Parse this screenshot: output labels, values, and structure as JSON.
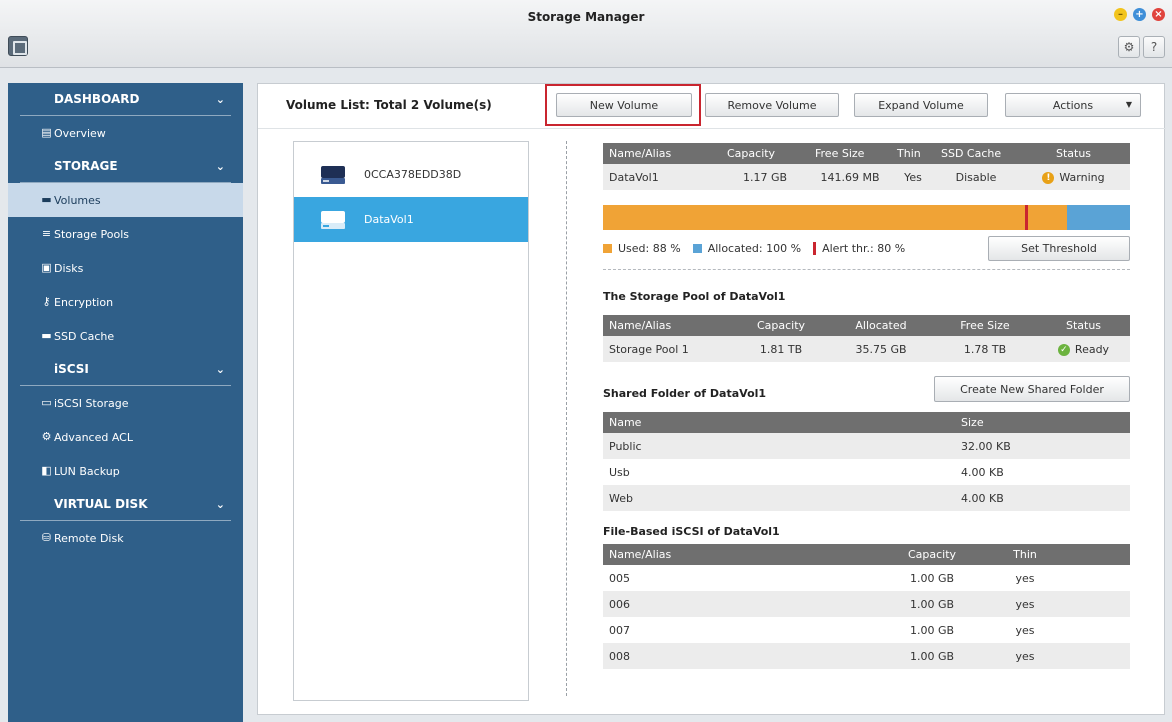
{
  "window": {
    "title": "Storage Manager"
  },
  "sidebar": {
    "sections": [
      {
        "label": "DASHBOARD",
        "items": [
          {
            "label": "Overview",
            "icon": "overview-icon"
          }
        ]
      },
      {
        "label": "STORAGE",
        "items": [
          {
            "label": "Volumes",
            "icon": "volume-icon",
            "active": true
          },
          {
            "label": "Storage Pools",
            "icon": "storage-pool-icon"
          },
          {
            "label": "Disks",
            "icon": "disk-icon"
          },
          {
            "label": "Encryption",
            "icon": "key-icon"
          },
          {
            "label": "SSD Cache",
            "icon": "ssd-icon"
          }
        ]
      },
      {
        "label": "iSCSI",
        "items": [
          {
            "label": "iSCSI Storage",
            "icon": "iscsi-storage-icon"
          },
          {
            "label": "Advanced ACL",
            "icon": "gear-icon"
          },
          {
            "label": "LUN Backup",
            "icon": "lun-backup-icon"
          }
        ]
      },
      {
        "label": "VIRTUAL DISK",
        "items": [
          {
            "label": "Remote Disk",
            "icon": "remote-disk-icon"
          }
        ]
      }
    ]
  },
  "toolbar": {
    "volume_list_title": "Volume List: Total 2 Volume(s)",
    "new_volume": "New Volume",
    "remove_volume": "Remove Volume",
    "expand_volume": "Expand Volume",
    "actions": "Actions"
  },
  "volumes": [
    {
      "label": "0CCA378EDD38D"
    },
    {
      "label": "DataVol1",
      "selected": true
    }
  ],
  "volume_info": {
    "headers": [
      "Name/Alias",
      "Capacity",
      "Free Size",
      "Thin",
      "SSD Cache",
      "Status"
    ],
    "row": [
      "DataVol1",
      "1.17 GB",
      "141.69 MB",
      "Yes",
      "Disable",
      "Warning"
    ],
    "used_percent": 88,
    "allocated_percent": 100,
    "alert_threshold_percent": 80,
    "legend_used": "Used: 88 %",
    "legend_allocated": "Allocated: 100 %",
    "legend_alert": "Alert thr.: 80 %",
    "set_threshold": "Set Threshold",
    "colors": {
      "used": "#f0a336",
      "allocated": "#5aa3d6",
      "alert": "#c9252f"
    }
  },
  "storage_pool": {
    "title": "The Storage Pool of DataVol1",
    "headers": [
      "Name/Alias",
      "Capacity",
      "Allocated",
      "Free Size",
      "Status"
    ],
    "row": [
      "Storage Pool 1",
      "1.81 TB",
      "35.75 GB",
      "1.78 TB",
      "Ready"
    ]
  },
  "shared_folders": {
    "title": "Shared Folder of DataVol1",
    "create_button": "Create New Shared Folder",
    "headers": [
      "Name",
      "Size"
    ],
    "rows": [
      [
        "Public",
        "32.00 KB"
      ],
      [
        "Usb",
        "4.00 KB"
      ],
      [
        "Web",
        "4.00 KB"
      ]
    ]
  },
  "iscsi": {
    "title": "File-Based iSCSI of DataVol1",
    "headers": [
      "Name/Alias",
      "Capacity",
      "Thin"
    ],
    "rows": [
      [
        "005",
        "1.00 GB",
        "yes"
      ],
      [
        "006",
        "1.00 GB",
        "yes"
      ],
      [
        "007",
        "1.00 GB",
        "yes"
      ],
      [
        "008",
        "1.00 GB",
        "yes"
      ]
    ]
  }
}
